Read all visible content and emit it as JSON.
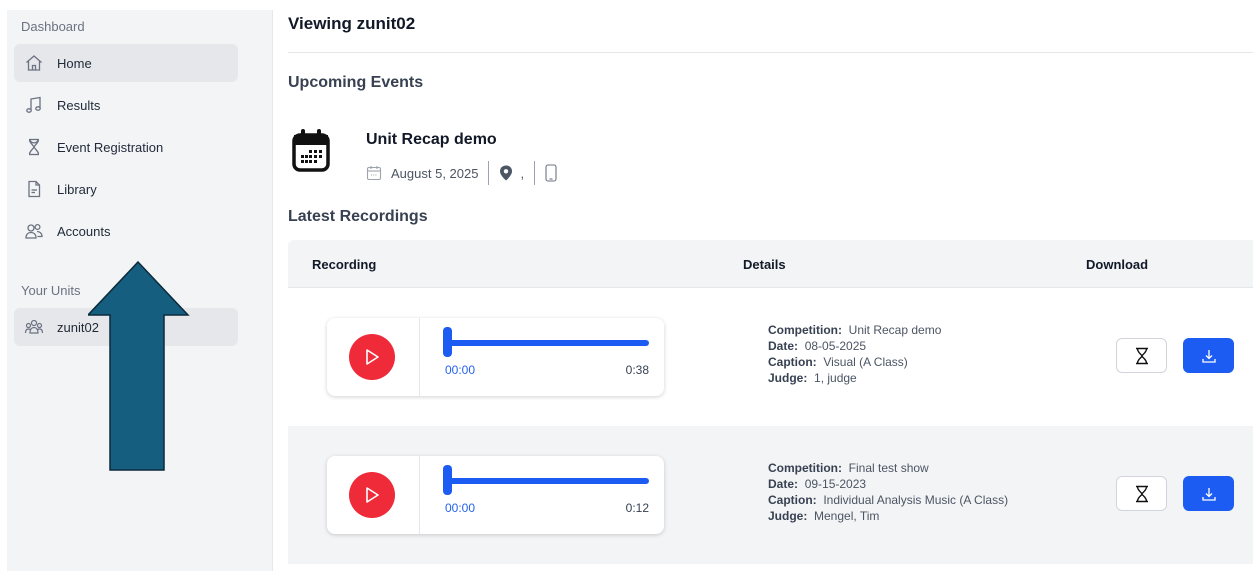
{
  "sidebar": {
    "dashboard_label": "Dashboard",
    "items": [
      {
        "label": "Home",
        "icon": "home-icon",
        "active": true
      },
      {
        "label": "Results",
        "icon": "music-note-icon"
      },
      {
        "label": "Event Registration",
        "icon": "trophy-icon"
      },
      {
        "label": "Library",
        "icon": "document-icon"
      },
      {
        "label": "Accounts",
        "icon": "users-icon"
      }
    ],
    "units_label": "Your Units",
    "units": [
      {
        "label": "zunit02",
        "icon": "users-icon",
        "active": true
      }
    ]
  },
  "main": {
    "title": "Viewing zunit02",
    "upcoming_heading": "Upcoming Events",
    "event": {
      "name": "Unit Recap demo",
      "date": "August 5, 2025",
      "location": ","
    },
    "recordings_heading": "Latest Recordings",
    "table": {
      "columns": [
        "Recording",
        "Details",
        "Download"
      ],
      "rows": [
        {
          "current_time": "00:00",
          "duration": "0:38",
          "competition_label": "Competition:",
          "competition": "Unit Recap demo",
          "date_label": "Date:",
          "date": "08-05-2025",
          "caption_label": "Caption:",
          "caption": "Visual (A Class)",
          "judge_label": "Judge:",
          "judge": "1, judge"
        },
        {
          "current_time": "00:00",
          "duration": "0:12",
          "competition_label": "Competition:",
          "competition": "Final test show",
          "date_label": "Date:",
          "date": "09-15-2023",
          "caption_label": "Caption:",
          "caption": "Individual Analysis Music (A Class)",
          "judge_label": "Judge:",
          "judge": "Mengel, Tim"
        }
      ]
    }
  },
  "colors": {
    "accent_blue": "#1d5cf2",
    "play_red": "#ef2b3a",
    "annotation_arrow": "#155e80"
  }
}
